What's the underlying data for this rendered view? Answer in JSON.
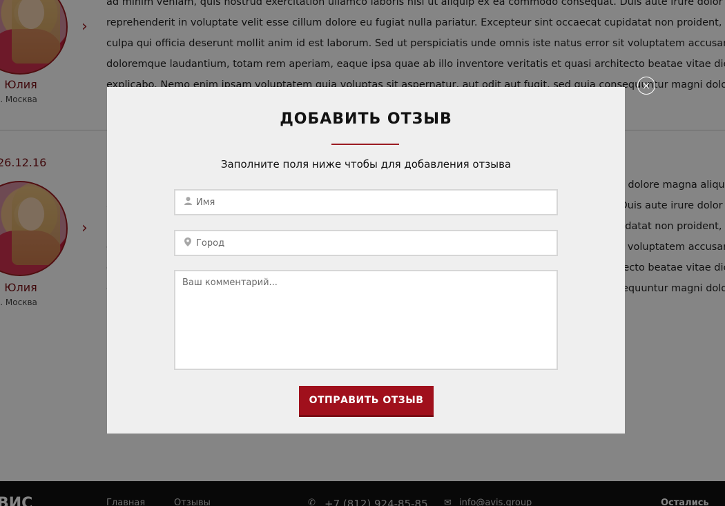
{
  "reviews": [
    {
      "name": "Юлия",
      "city": "г. Москва",
      "date": "",
      "lines": [
        "ad minim veniam, quis nostrud exercitation ullamco laboris nisi ut aliquip ex ea commodo consequat. Duis aute irure dolor in",
        "reprehenderit in voluptate velit esse cillum dolore eu fugiat nulla pariatur. Excepteur sint occaecat cupidatat non proident, sunt",
        "culpa qui officia deserunt mollit anim id est laborum. Sed ut perspiciatis unde omnis iste natus error sit voluptatem accusantiu",
        "doloremque laudantium, totam rem aperiam, eaque ipsa quae ab illo inventore veritatis et quasi architecto beatae vitae dicta su",
        "explicabo. Nemo enim ipsam voluptatem quia voluptas sit aspernatur, aut odit aut fugit, sed quia consequuntur magni dolores e"
      ]
    },
    {
      "name": "Юлия",
      "city": "г. Москва",
      "date": "26.12.16",
      "lines": [
        "Lorem ipsum dolor sit amet, consectetur adipisicing elit, sed do eiusmod tempor incididunt ut labore et dolore magna aliqua. U",
        "ad minim veniam, quis nostrud exercitation ullamco laboris nisi ut aliquip ex ea commodo consequat. Duis aute irure dolor in",
        "reprehenderit in voluptate velit esse cillum dolore eu fugiat nulla pariatur. Excepteur sint occaecat cupidatat non proident, sunt",
        "culpa qui officia deserunt mollit anim id est laborum. Sed ut perspiciatis unde omnis iste natus error sit voluptatem accusantiu",
        "doloremque laudantium, totam rem aperiam, eaque ipsa quae ab illo inventore veritatis et quasi architecto beatae vitae dicta su",
        "explicabo. Nemo enim ipsam voluptatem quia voluptas sit aspernatur, aut odit aut fugit, sed quia consequuntur magni dolores e"
      ]
    }
  ],
  "footer": {
    "logo": "ВИС",
    "nav": [
      "Главная",
      "Отзывы"
    ],
    "phone": "+7 (812) 924-85-85",
    "email": "info@avis.group",
    "cta": "Остались воп"
  },
  "modal": {
    "title": "ДОБАВИТЬ ОТЗЫВ",
    "subtitle": "Заполните поля ниже чтобы для добавления отзыва",
    "name_placeholder": "Имя",
    "city_placeholder": "Город",
    "comment_placeholder": "Ваш комментарий...",
    "submit_label": "ОТПРАВИТЬ ОТЗЫВ",
    "close_glyph": "×"
  },
  "colors": {
    "accent": "#9b1b22",
    "button": "#a0101c",
    "modal_bg": "#efefef"
  },
  "icons": {
    "chevron": "chevron-right-icon",
    "user": "user-icon",
    "location": "location-pin-icon",
    "close": "close-icon",
    "phone": "phone-icon",
    "mail": "mail-icon"
  }
}
